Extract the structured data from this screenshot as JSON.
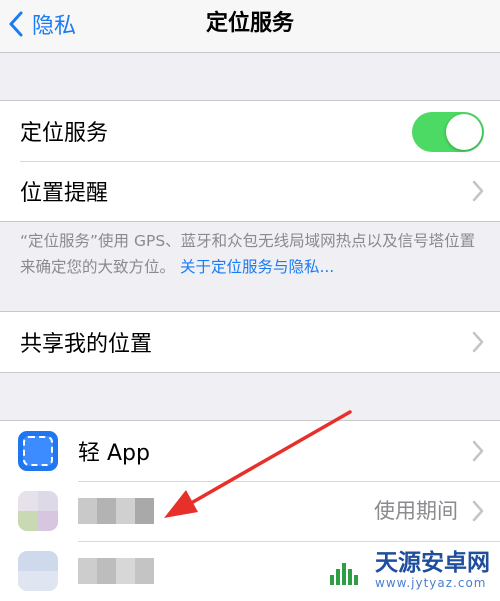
{
  "navbar": {
    "back_label": "隐私",
    "title": "定位服务"
  },
  "group_location": {
    "location_services_label": "定位服务",
    "location_services_on": true,
    "location_alerts_label": "位置提醒"
  },
  "footnote": {
    "text": "“定位服务”使用 GPS、蓝牙和众包无线局域网热点以及信号塔位置来确定您的大致方位。",
    "link": "关于定位服务与隐私..."
  },
  "share_location_label": "共享我的位置",
  "apps": [
    {
      "name": "轻 App",
      "icon": "light-app-icon"
    },
    {
      "name": "",
      "value": "使用期间",
      "icon": "blurred-app-icon"
    },
    {
      "name": "",
      "icon": "blurred-app-icon"
    }
  ],
  "watermark": {
    "title": "天源安卓网",
    "url": "www.jytyaz.com"
  },
  "colors": {
    "accent": "#1a7cf5",
    "toggle_on": "#4cd964",
    "annotation_arrow": "#e8302a",
    "background": "#efeff4"
  }
}
